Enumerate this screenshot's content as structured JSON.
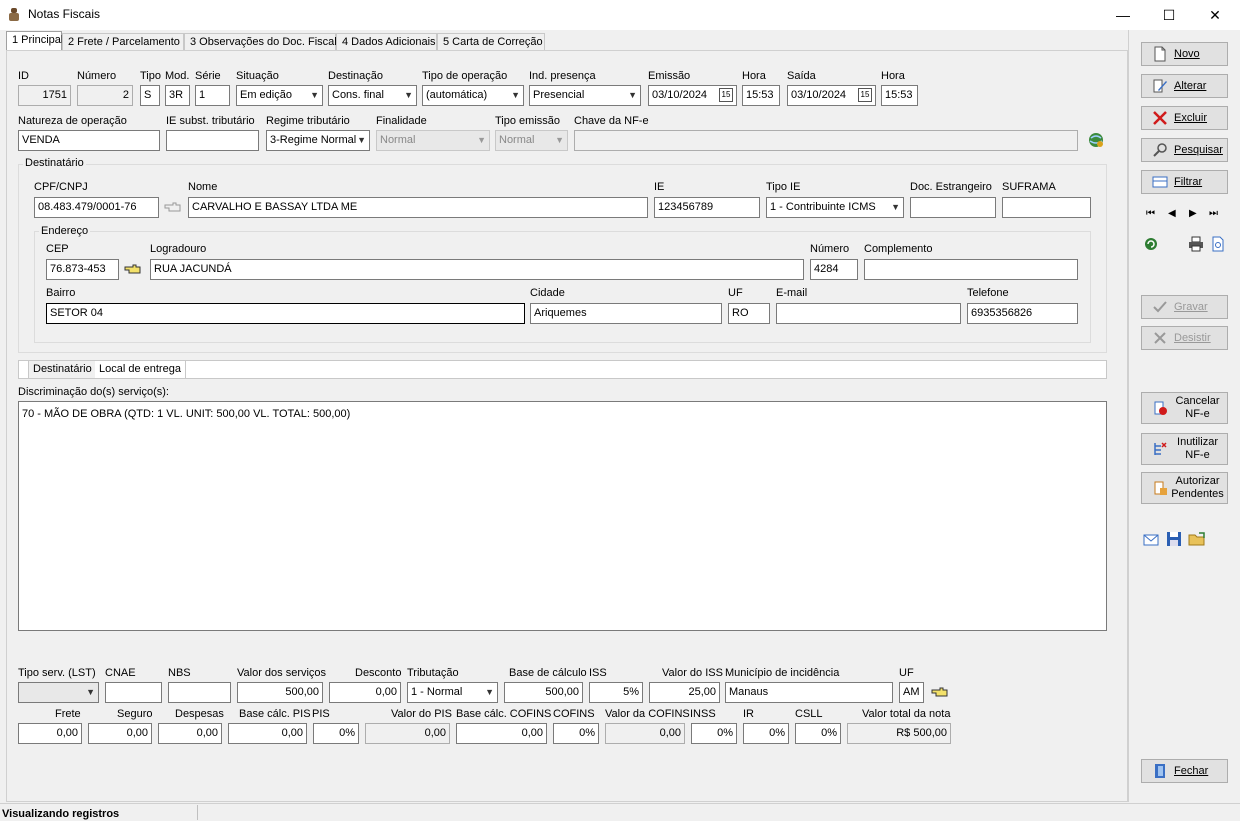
{
  "window": {
    "title": "Notas Fiscais",
    "minimize": "—",
    "maximize": "☐",
    "close": "✕"
  },
  "tabs": [
    "1 Principal",
    "2 Frete / Parcelamento",
    "3 Observações do Doc. Fiscal",
    "4 Dados Adicionais",
    "5 Carta de Correção"
  ],
  "header": {
    "labels": {
      "id": "ID",
      "numero": "Número",
      "tipo": "Tipo",
      "mod": "Mod.",
      "serie": "Série",
      "situacao": "Situação",
      "destinacao": "Destinação",
      "tipo_operacao": "Tipo de operação",
      "ind_presenca": "Ind. presença",
      "emissao": "Emissão",
      "hora": "Hora",
      "saida": "Saída",
      "hora2": "Hora"
    },
    "values": {
      "id": "1751",
      "numero": "2",
      "tipo": "S",
      "mod": "3R",
      "serie": "1",
      "situacao": "Em edição",
      "destinacao": "Cons. final",
      "tipo_operacao": "(automática)",
      "ind_presenca": "Presencial",
      "emissao": "03/10/2024",
      "hora": "15:53",
      "saida": "03/10/2024",
      "hora2": "15:53"
    }
  },
  "row2": {
    "labels": {
      "natureza": "Natureza de operação",
      "ie_subst": "IE subst. tributário",
      "regime": "Regime tributário",
      "finalidade": "Finalidade",
      "tipo_emissao": "Tipo emissão",
      "chave": "Chave da NF-e"
    },
    "values": {
      "natureza": "VENDA",
      "ie_subst": "",
      "regime": "3-Regime Normal",
      "finalidade": "Normal",
      "tipo_emissao": "Normal",
      "chave": ""
    }
  },
  "destinatario": {
    "group_title": "Destinatário",
    "labels": {
      "cpf": "CPF/CNPJ",
      "nome": "Nome",
      "ie": "IE",
      "tipo_ie": "Tipo IE",
      "doc_estrangeiro": "Doc. Estrangeiro",
      "suframa": "SUFRAMA"
    },
    "values": {
      "cpf": "08.483.479/0001-76",
      "nome": "CARVALHO E BASSAY LTDA ME",
      "ie": "123456789",
      "tipo_ie": "1 - Contribuinte ICMS",
      "doc_estrangeiro": "",
      "suframa": ""
    },
    "endereco": {
      "group_title": "Endereço",
      "labels": {
        "cep": "CEP",
        "logradouro": "Logradouro",
        "numero": "Número",
        "complemento": "Complemento",
        "bairro": "Bairro",
        "cidade": "Cidade",
        "uf": "UF",
        "email": "E-mail",
        "telefone": "Telefone"
      },
      "values": {
        "cep": "76.873-453",
        "logradouro": "RUA JACUNDÁ",
        "numero": "4284",
        "complemento": "",
        "bairro": "SETOR 04",
        "cidade": "Ariquemes",
        "uf": "RO",
        "email": "",
        "telefone": "6935356826"
      }
    }
  },
  "subtabs": [
    "Destinatário",
    "Local de entrega"
  ],
  "servicos": {
    "label": "Discriminação do(s) serviço(s):",
    "text": "70 - MÃO DE OBRA (QTD: 1 VL. UNIT: 500,00 VL. TOTAL: 500,00)"
  },
  "totais1": {
    "labels": {
      "tipo_serv": "Tipo serv. (LST)",
      "cnae": "CNAE",
      "nbs": "NBS",
      "valor_servicos": "Valor dos serviços",
      "desconto": "Desconto",
      "tributacao": "Tributação",
      "base_calculo": "Base de cálculo",
      "iss": "ISS",
      "valor_iss": "Valor do ISS",
      "municipio": "Município de incidência",
      "uf": "UF"
    },
    "values": {
      "tipo_serv": "",
      "cnae": "",
      "nbs": "",
      "valor_servicos": "500,00",
      "desconto": "0,00",
      "tributacao": "1 - Normal",
      "base_calculo": "500,00",
      "iss": "5%",
      "valor_iss": "25,00",
      "municipio": "Manaus",
      "uf": "AM"
    }
  },
  "totais2": {
    "labels": {
      "frete": "Frete",
      "seguro": "Seguro",
      "despesas": "Despesas",
      "base_pis": "Base cálc. PIS",
      "pis": "PIS",
      "valor_pis": "Valor do PIS",
      "base_cofins": "Base cálc. COFINS",
      "cofins": "COFINS",
      "valor_cofins": "Valor da COFINS",
      "inss": "INSS",
      "ir": "IR",
      "csll": "CSLL",
      "valor_total": "Valor total da nota"
    },
    "values": {
      "frete": "0,00",
      "seguro": "0,00",
      "despesas": "0,00",
      "base_pis": "0,00",
      "pis": "0%",
      "valor_pis": "0,00",
      "base_cofins": "0,00",
      "cofins": "0%",
      "valor_cofins": "0,00",
      "inss": "0%",
      "ir": "0%",
      "csll": "0%",
      "valor_total": "R$ 500,00"
    }
  },
  "sidebar": {
    "novo": "Novo",
    "alterar": "Alterar",
    "excluir": "Excluir",
    "pesquisar": "Pesquisar",
    "filtrar": "Filtrar",
    "gravar": "Gravar",
    "desistir": "Desistir",
    "cancelar_l1": "Cancelar",
    "cancelar_l2": "NF-e",
    "inutilizar_l1": "Inutilizar",
    "inutilizar_l2": "NF-e",
    "autorizar_l1": "Autorizar",
    "autorizar_l2": "Pendentes",
    "fechar": "Fechar",
    "nav": {
      "first": "⏮",
      "prev": "◀",
      "next": "▶",
      "last": "⏭"
    }
  },
  "status": {
    "text": "Visualizando registros"
  },
  "colors": {
    "accent": "#0078d7",
    "error": "#cc0000",
    "disabled": "#999999"
  }
}
